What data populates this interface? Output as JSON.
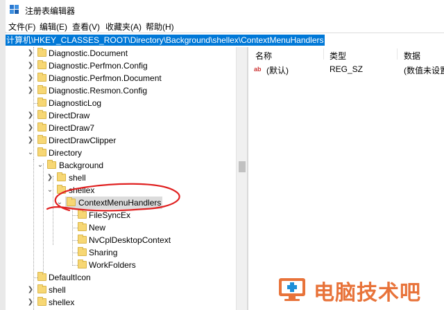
{
  "window": {
    "title": "注册表编辑器",
    "accent_color": "#0078d7"
  },
  "menu": [
    {
      "label": "文件(F)"
    },
    {
      "label": "编辑(E)"
    },
    {
      "label": "查看(V)"
    },
    {
      "label": "收藏夹(A)"
    },
    {
      "label": "帮助(H)"
    }
  ],
  "address": {
    "path": "计算机\\HKEY_CLASSES_ROOT\\Directory\\Background\\shellex\\ContextMenuHandlers"
  },
  "tree": {
    "items": [
      {
        "label": "Diagnostic.Document",
        "expander": "collapsed"
      },
      {
        "label": "Diagnostic.Perfmon.Config",
        "expander": "collapsed"
      },
      {
        "label": "Diagnostic.Perfmon.Document",
        "expander": "collapsed"
      },
      {
        "label": "Diagnostic.Resmon.Config",
        "expander": "collapsed"
      },
      {
        "label": "DiagnosticLog",
        "expander": "none"
      },
      {
        "label": "DirectDraw",
        "expander": "collapsed"
      },
      {
        "label": "DirectDraw7",
        "expander": "collapsed"
      },
      {
        "label": "DirectDrawClipper",
        "expander": "collapsed"
      },
      {
        "label": "Directory",
        "expander": "expanded"
      },
      {
        "label": "Background",
        "expander": "expanded"
      },
      {
        "label": "shell",
        "expander": "collapsed"
      },
      {
        "label": "shellex",
        "expander": "expanded"
      },
      {
        "label": "ContextMenuHandlers",
        "expander": "expanded",
        "selected": true
      },
      {
        "label": "FileSyncEx",
        "expander": "none"
      },
      {
        "label": "New",
        "expander": "none"
      },
      {
        "label": "NvCplDesktopContext",
        "expander": "none"
      },
      {
        "label": "Sharing",
        "expander": "none"
      },
      {
        "label": "WorkFolders",
        "expander": "none"
      },
      {
        "label": "DefaultIcon",
        "expander": "none"
      },
      {
        "label": "shell",
        "expander": "collapsed"
      },
      {
        "label": "shellex",
        "expander": "collapsed"
      }
    ]
  },
  "values": {
    "headers": {
      "name": "名称",
      "type": "类型",
      "data": "数据"
    },
    "rows": [
      {
        "icon": "string-value-icon",
        "name": "(默认)",
        "type": "REG_SZ",
        "data": "(数值未设置"
      }
    ]
  },
  "annotation": {
    "color": "#e02020"
  },
  "watermark": {
    "text": "电脑技术吧",
    "color": "#e8733a"
  }
}
